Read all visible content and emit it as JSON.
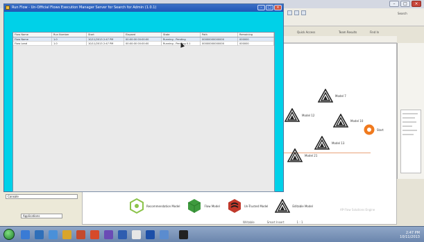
{
  "dialog": {
    "title": "Run Flow - Un-Official Flows Execution Manager Server for Search for Admin (1.0.1)",
    "columns": [
      "Flow Name",
      "Run Number",
      "Start",
      "Elapsed",
      "State",
      "Path",
      "Remaining"
    ],
    "rows": [
      [
        "Flow Name",
        "1.0",
        "10/11/2013 2:47 PM",
        "00:00:00 00:00:00",
        "Running - Pending",
        "00000000000000",
        "000000"
      ],
      [
        "Flow Lead",
        "1.0",
        "10/11/2013 2:47 PM",
        "00:00:00 00:00:00",
        "Running - Pending 0.1",
        "00000000000000",
        "000000"
      ]
    ]
  },
  "toolbar": {
    "quick_access": "Quick Access",
    "team_results": "Team Results",
    "find_in": "Find In",
    "search": "Search"
  },
  "canvas": {
    "nodes": [
      {
        "label": "Model 7",
        "icon": "spiral-model-icon"
      },
      {
        "label": "Model 12",
        "icon": "spiral-model-icon"
      },
      {
        "label": "Model 10",
        "icon": "spiral-model-icon"
      },
      {
        "label": "Model 13",
        "icon": "spiral-model-icon"
      },
      {
        "label": "Model 21",
        "icon": "spiral-model-icon"
      },
      {
        "label": "Start",
        "icon": "start-node-icon",
        "color": "#f07a1e"
      }
    ],
    "legend": [
      {
        "label": "Recommendation Model",
        "icon": "recommendation-hexagon-icon",
        "color": "#8bc34a"
      },
      {
        "label": "Flow Model",
        "icon": "flow-cube-icon",
        "color": "#3e9a3e"
      },
      {
        "label": "Un-Trusted Model",
        "icon": "untrusted-model-icon",
        "color": "#c0392b"
      },
      {
        "label": "Editable Model",
        "icon": "spiral-model-icon",
        "color": "#222222"
      }
    ],
    "watermark": "AP-Flow Solutions Engine"
  },
  "left_panel": {
    "field_1": "Console",
    "field_2": "Applications"
  },
  "status_bar": {
    "item_1": "Writable",
    "item_2": "Smart Insert",
    "item_3": "1 : 1"
  },
  "taskbar": {
    "time": "2:47 PM",
    "date": "10/11/2013"
  },
  "colors": {
    "dialog_bg": "#00d1e8",
    "accent_orange": "#f07a1e"
  }
}
